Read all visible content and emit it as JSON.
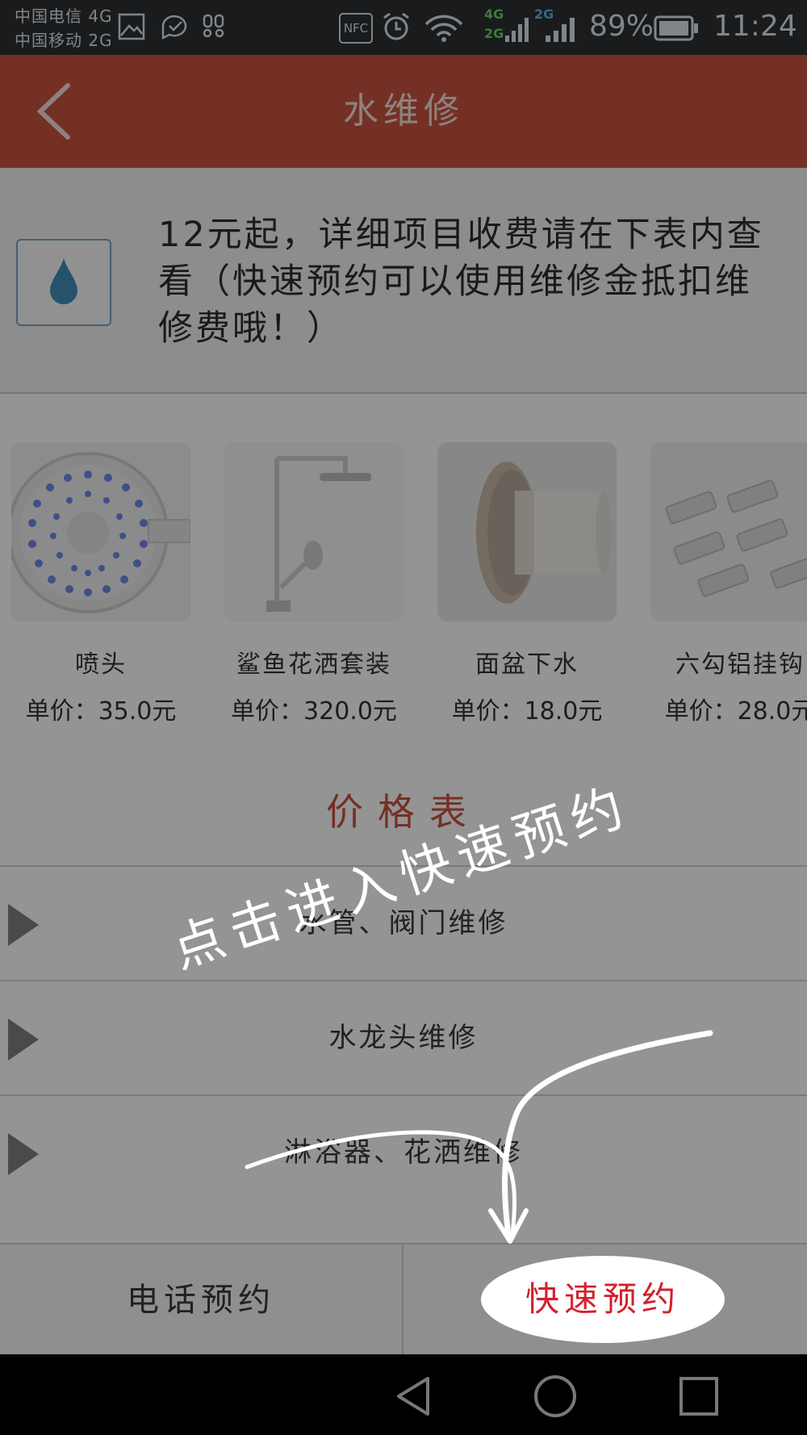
{
  "status_bar": {
    "carrier_1": "中国电信 4G",
    "carrier_2": "中国移动 2G",
    "nfc": "NFC",
    "net_top": "4G",
    "net_bottom": "2G",
    "net_right": "2G",
    "battery": "89%",
    "time": "11:24"
  },
  "header": {
    "title": "水维修",
    "back_icon": "chevron-left-icon"
  },
  "intro": {
    "text": "12元起，详细项目收费请在下表内查看（快速预约可以使用维修金抵扣维修费哦！）",
    "icon": "water-drop-icon"
  },
  "products": [
    {
      "name": "喷头",
      "price": "单价：35.0元"
    },
    {
      "name": "鲨鱼花洒套装",
      "price": "单价：320.0元"
    },
    {
      "name": "面盆下水",
      "price": "单价：18.0元"
    },
    {
      "name": "六勾铝挂钩",
      "price": "单价：28.0元"
    }
  ],
  "price_table": {
    "title": "价格表",
    "rows": [
      {
        "label": "水管、阀门维修"
      },
      {
        "label": "水龙头维修"
      },
      {
        "label": "淋浴器、花洒维修"
      }
    ]
  },
  "bottom_bar": {
    "phone_label": "电话预约",
    "quick_label": "快速预约"
  },
  "guide": {
    "text": "点击进入快速预约"
  },
  "colors": {
    "header": "#c8533f",
    "accent_red": "#d3202a",
    "title_red": "#c8533f"
  }
}
